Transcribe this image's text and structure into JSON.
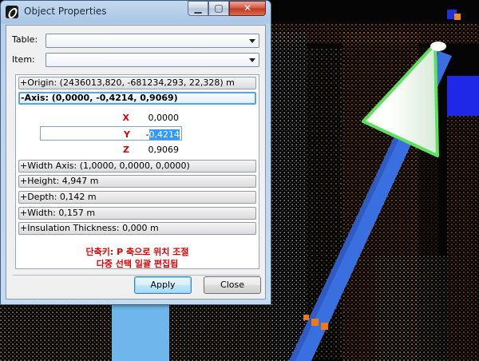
{
  "window": {
    "title": "Object Properties",
    "minimize_glyph": "▁",
    "maximize_glyph": "▢",
    "close_glyph": "✕"
  },
  "form": {
    "table_label": "Table:",
    "table_value": "",
    "item_label": "Item:",
    "item_value": ""
  },
  "properties": [
    {
      "label": "+Origin: (2436013,820, -681234,293, 22,328) m",
      "selected": false
    },
    {
      "label": "-Axis: (0,0000, -0,4214, 0,9069)",
      "selected": true
    },
    {
      "label": "+Width Axis: (1,0000, 0,0000, 0,0000)",
      "selected": false
    },
    {
      "label": "+Height: 4,947 m",
      "selected": false
    },
    {
      "label": "+Depth: 0,142 m",
      "selected": false
    },
    {
      "label": "+Width: 0,157 m",
      "selected": false
    },
    {
      "label": "+Insulation Thickness: 0,000 m",
      "selected": false
    }
  ],
  "axis_components": [
    {
      "label": "X",
      "value": "0,0000"
    },
    {
      "label": "Y",
      "value_prefix": "-",
      "value_selected": "0,4214"
    },
    {
      "label": "Z",
      "value": "0,9069"
    }
  ],
  "hints": [
    "단축키: P 축으로 위치 조절",
    "다중 선택 일괄 편집됨"
  ],
  "buttons": {
    "apply": "Apply",
    "close": "Close"
  },
  "colors": {
    "accent_blue": "#3399ff",
    "hint_red": "#e00000",
    "pipe_blue": "#3a6fe0",
    "cone_green": "#55e05a",
    "points_orange": "#e07a18"
  }
}
